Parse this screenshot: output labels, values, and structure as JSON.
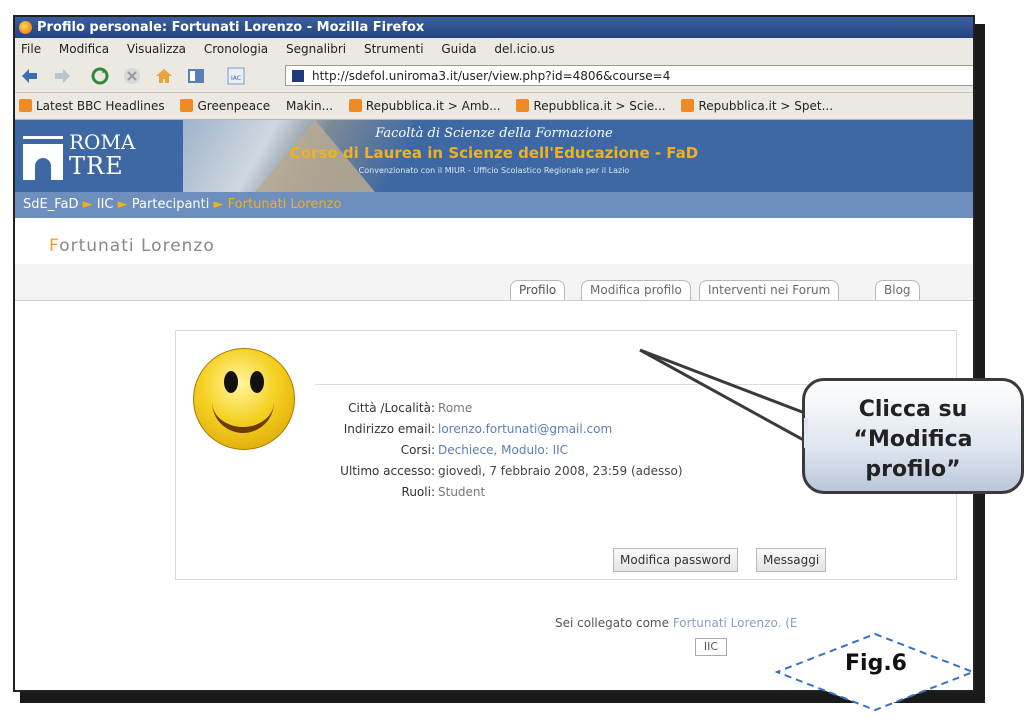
{
  "window": {
    "title": "Profilo personale: Fortunati Lorenzo - Mozilla Firefox"
  },
  "menu": [
    "File",
    "Modifica",
    "Visualizza",
    "Cronologia",
    "Segnalibri",
    "Strumenti",
    "Guida",
    "del.icio.us"
  ],
  "address": {
    "url": "http://sdefol.uniroma3.it/user/view.php?id=4806&course=4"
  },
  "bookmarks": [
    "Latest BBC Headlines",
    "Greenpeace",
    "Makin...",
    "Repubblica.it > Amb...",
    "Repubblica.it > Scie...",
    "Repubblica.it > Spet..."
  ],
  "banner": {
    "logo_line1": "ROMA",
    "logo_line2": "TRE",
    "faculty": "Facoltà di Scienze della Formazione",
    "course": "Corso di Laurea in Scienze dell'Educazione - FaD",
    "note": "Convenzionato con il MIUR - Ufficio Scolastico Regionale per il Lazio"
  },
  "breadcrumb": {
    "items": [
      "SdE_FaD",
      "IIC",
      "Partecipanti"
    ],
    "current": "Fortunati Lorenzo",
    "separator": "►"
  },
  "profile": {
    "name": "Fortunati Lorenzo",
    "tabs": [
      "Profilo",
      "Modifica profilo",
      "Interventi nei Forum",
      "Blog"
    ],
    "fields": [
      {
        "label": "Città /Località:",
        "value": "Rome"
      },
      {
        "label": "Indirizzo email:",
        "value": "lorenzo.fortunati@gmail.com"
      },
      {
        "label": "Corsi:",
        "value": "Dechiece, Modulo: IIC"
      },
      {
        "label": "Ultimo accesso:",
        "value": "giovedì, 7 febbraio 2008, 23:59  (adesso)"
      },
      {
        "label": "Ruoli:",
        "value": "Student"
      }
    ],
    "buttons": {
      "password": "Modifica password",
      "messages": "Messaggi"
    }
  },
  "footer": {
    "logged_prefix": "Sei collegato come",
    "logged_user": "Fortunati Lorenzo. (E",
    "course_button": "IIC"
  },
  "callout": {
    "line1": "Clicca su",
    "line2": "“Modifica",
    "line3": "profilo”"
  },
  "figure_label": "Fig.6",
  "colors": {
    "banner": "#3d68a3",
    "breadcrumb": "#6e8fbd",
    "accent": "#f0b020"
  }
}
